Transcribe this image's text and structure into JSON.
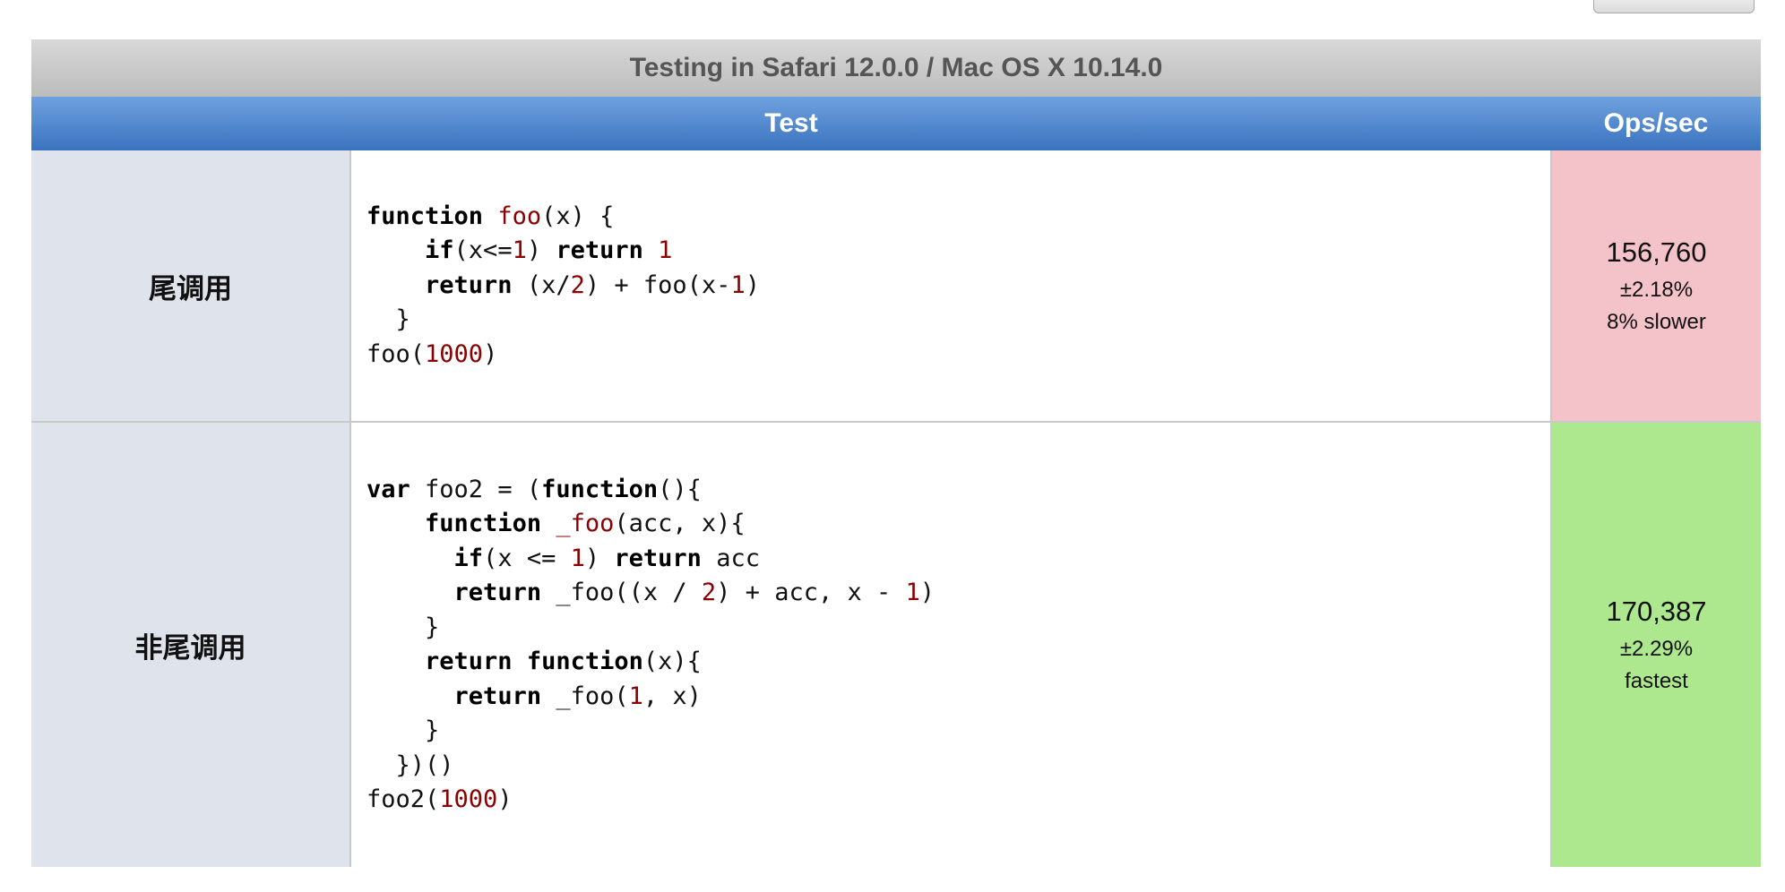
{
  "caption": "Testing in Safari 12.0.0 / Mac OS X 10.14.0",
  "headers": {
    "test": "Test",
    "ops": "Ops/sec"
  },
  "tests": [
    {
      "title": "尾调用",
      "ops": "156,760",
      "rme": "±2.18%",
      "status": "8% slower"
    },
    {
      "title": "非尾调用",
      "ops": "170,387",
      "rme": "±2.29%",
      "status": "fastest"
    }
  ],
  "colors": {
    "slower_bg": "#f4c2c9",
    "fastest_bg": "#aee88e",
    "header_blue": "#3a73be",
    "title_bg": "#dfe3eb"
  }
}
